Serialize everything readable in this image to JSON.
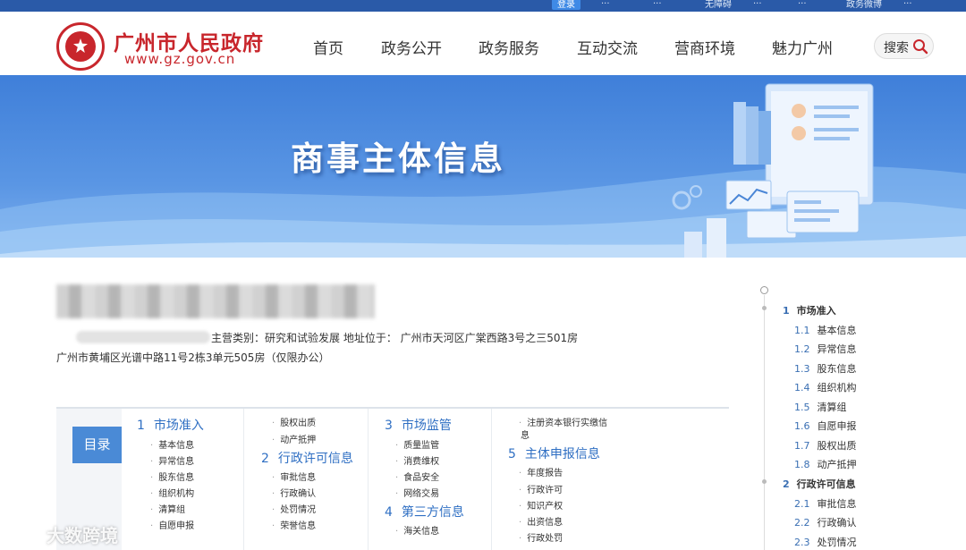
{
  "topbar": {
    "links": [
      "登录",
      "...",
      "无障碍",
      "...",
      "...",
      "...",
      "政务微博",
      "..."
    ]
  },
  "header": {
    "site_name": "广州市人民政府",
    "site_url": "www.gz.gov.cn",
    "nav": [
      "首页",
      "政务公开",
      "政务服务",
      "互动交流",
      "营商环境",
      "魅力广州"
    ],
    "search_label": "搜索"
  },
  "banner": {
    "title": "商事主体信息"
  },
  "entity": {
    "meta_line1": "主营类别：研究和试验发展  地址位于：  广州市天河区广棠西路3号之三501房",
    "meta_line2": "广州市黄埔区光谱中路11号2栋3单元505房（仅限办公）"
  },
  "toc": {
    "button": "目录",
    "col1": {
      "num": "1",
      "title": "市场准入",
      "items": [
        "基本信息",
        "异常信息",
        "股东信息",
        "组织机构",
        "清算组",
        "自愿申报"
      ]
    },
    "col2": {
      "pre_items": [
        "股权出质",
        "动产抵押"
      ],
      "num": "2",
      "title": "行政许可信息",
      "items": [
        "审批信息",
        "行政确认",
        "处罚情况",
        "荣誉信息"
      ]
    },
    "col3": {
      "num": "3",
      "title": "市场监管",
      "items": [
        "质量监管",
        "消费维权",
        "食品安全",
        "网络交易"
      ],
      "num2": "4",
      "title2": "第三方信息",
      "items2": [
        "海关信息"
      ]
    },
    "col4": {
      "pre_line1": "注册资本银行实缴信",
      "pre_line2": "息",
      "num": "5",
      "title": "主体申报信息",
      "items": [
        "年度报告",
        "行政许可",
        "知识产权",
        "出资信息",
        "行政处罚"
      ]
    }
  },
  "right_toc": {
    "sections": [
      {
        "num": "1",
        "title": "市场准入",
        "items": [
          {
            "num": "1.1",
            "label": "基本信息"
          },
          {
            "num": "1.2",
            "label": "异常信息"
          },
          {
            "num": "1.3",
            "label": "股东信息"
          },
          {
            "num": "1.4",
            "label": "组织机构"
          },
          {
            "num": "1.5",
            "label": "清算组"
          },
          {
            "num": "1.6",
            "label": "自愿申报"
          },
          {
            "num": "1.7",
            "label": "股权出质"
          },
          {
            "num": "1.8",
            "label": "动产抵押"
          }
        ]
      },
      {
        "num": "2",
        "title": "行政许可信息",
        "items": [
          {
            "num": "2.1",
            "label": "审批信息"
          },
          {
            "num": "2.2",
            "label": "行政确认"
          },
          {
            "num": "2.3",
            "label": "处罚情况"
          }
        ]
      }
    ]
  },
  "watermark": "大数跨境"
}
